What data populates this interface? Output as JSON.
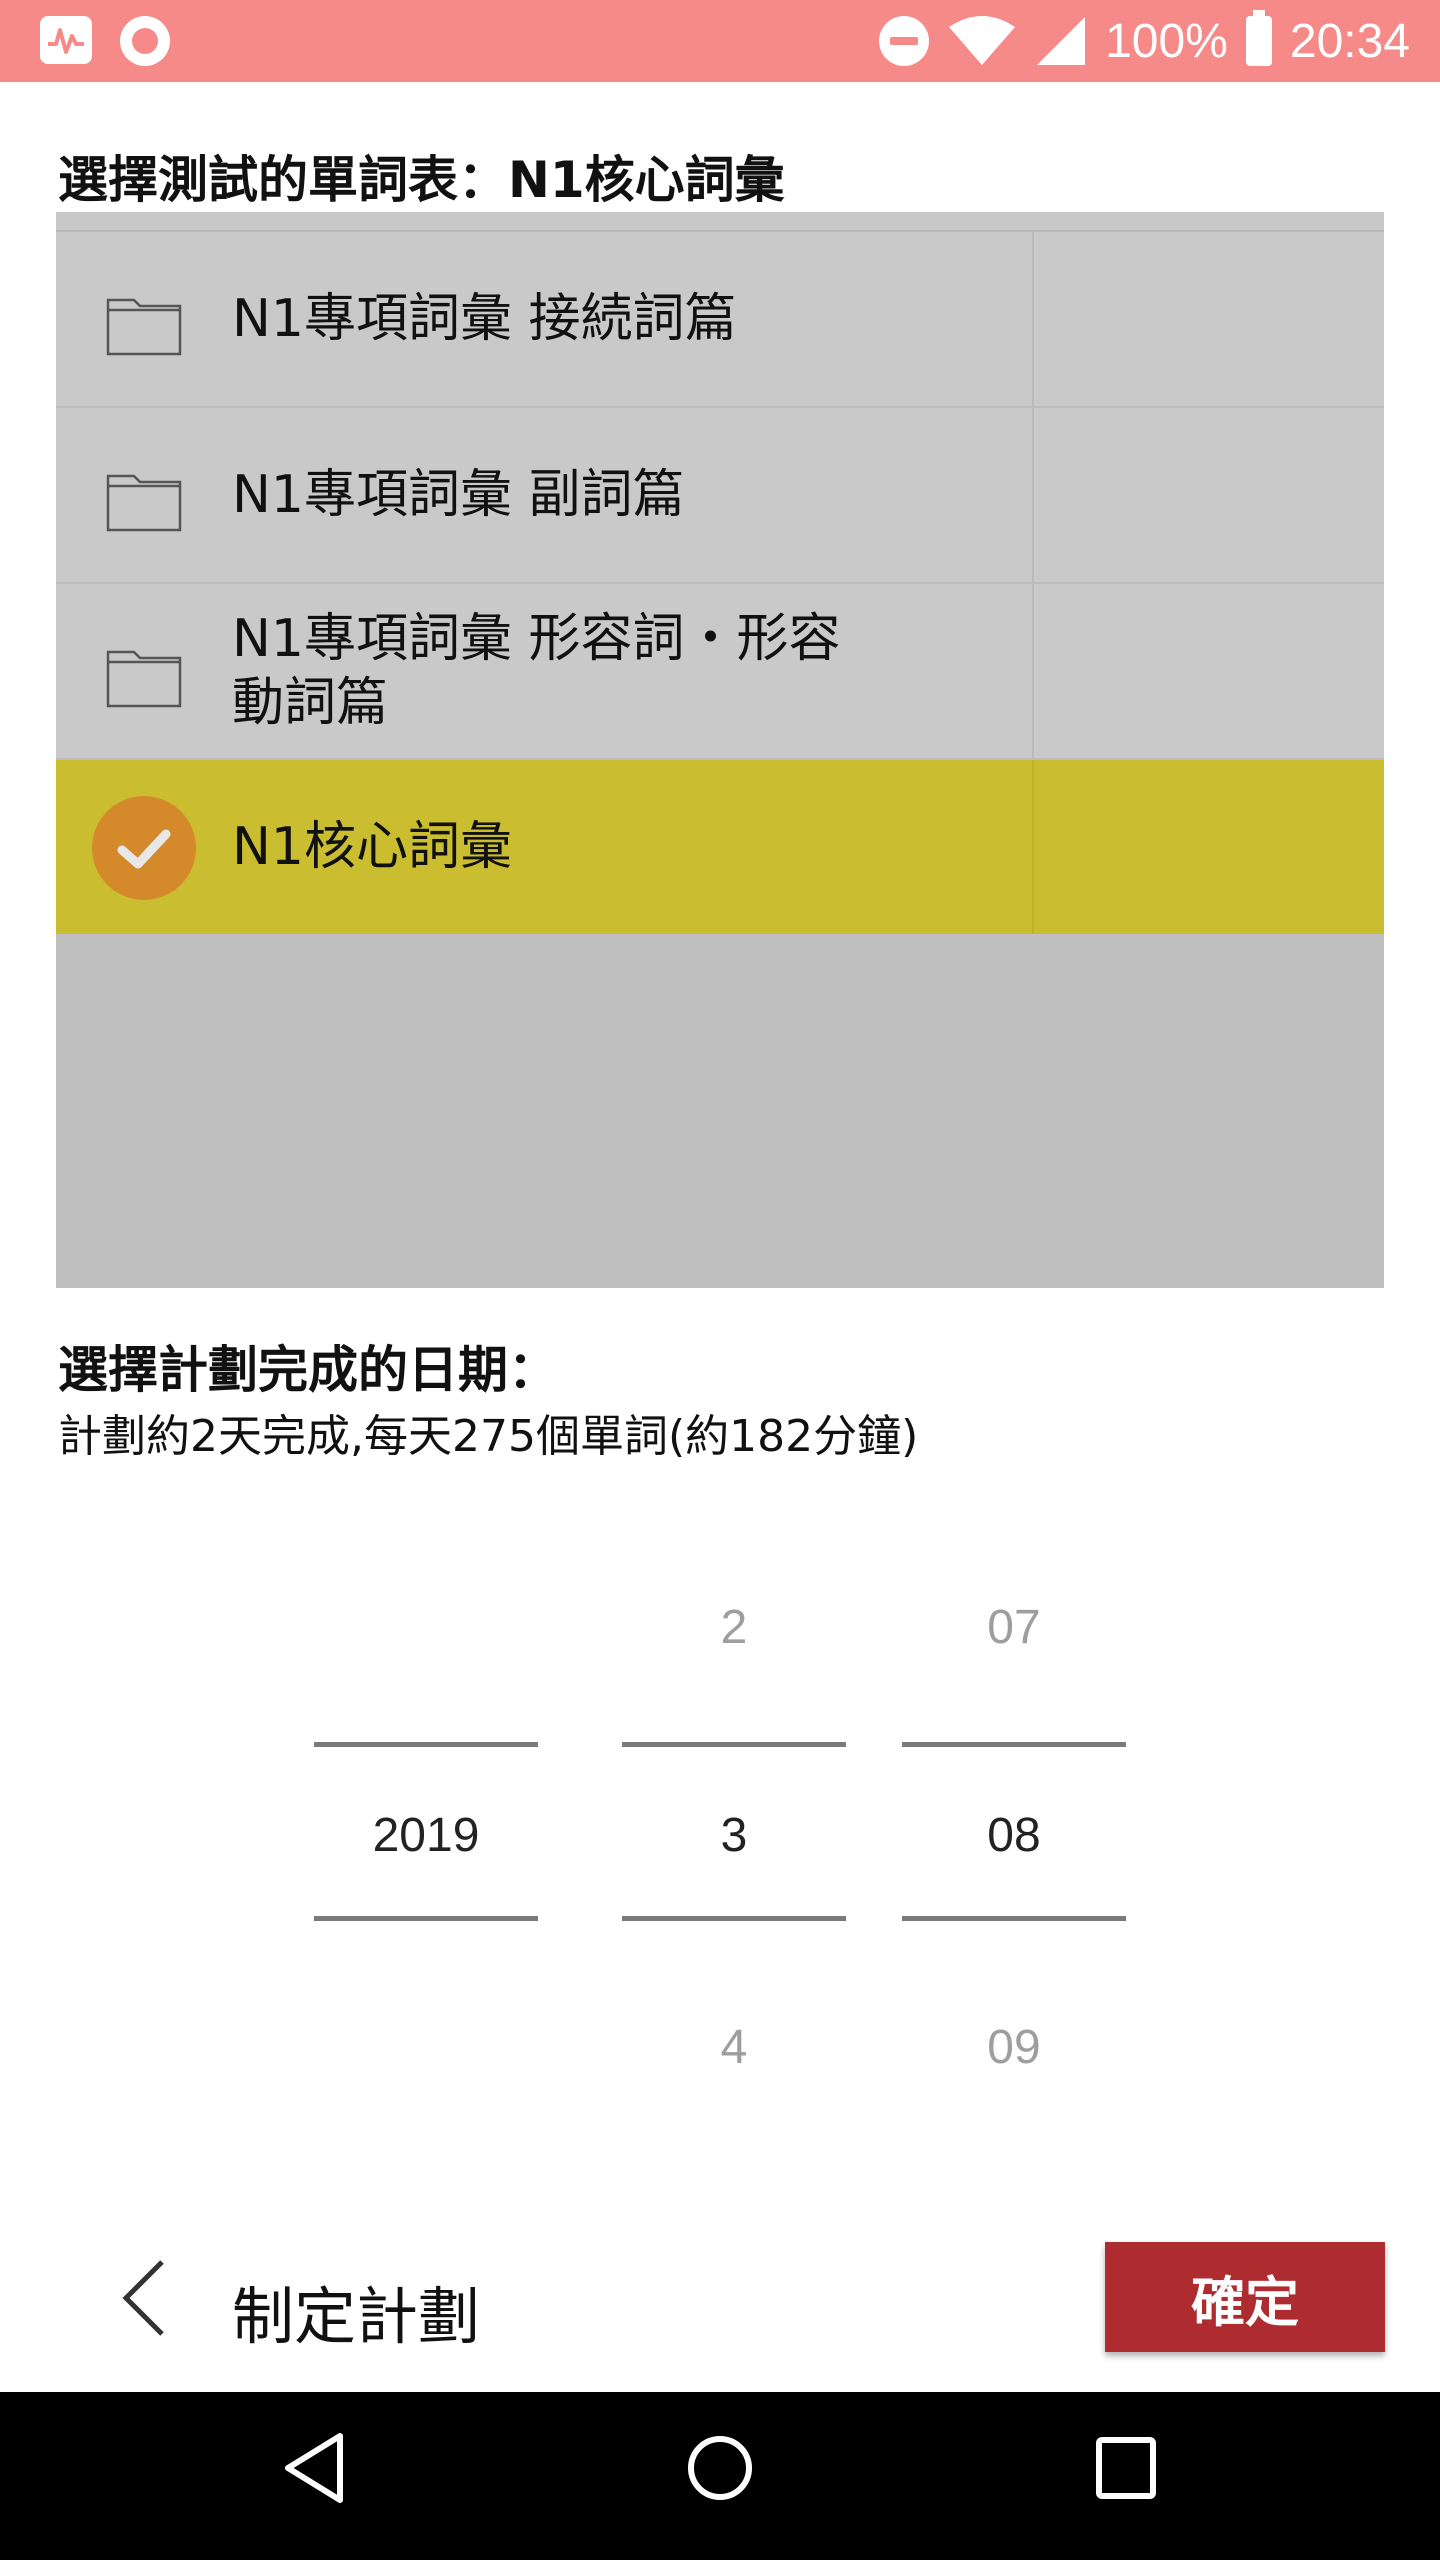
{
  "status_bar": {
    "battery": "100%",
    "time": "20:34",
    "icons": [
      "activity-icon",
      "record-icon",
      "do-not-disturb-icon",
      "wifi-icon",
      "signal-icon",
      "battery-charging-icon"
    ]
  },
  "wordlist_section": {
    "title": "選擇測試的單詞表：N1核心詞彙",
    "items": [
      {
        "label": "N1專項詞彙 接続詞篇",
        "icon": "folder-icon",
        "selected": false
      },
      {
        "label": "N1專項詞彙 副詞篇",
        "icon": "folder-icon",
        "selected": false
      },
      {
        "label": "N1專項詞彙 形容詞・形容動詞篇",
        "icon": "folder-icon",
        "selected": false
      },
      {
        "label": "N1核心詞彙",
        "icon": "check-icon",
        "selected": true
      }
    ]
  },
  "plan_section": {
    "title": "選擇計劃完成的日期：",
    "subtitle": "計劃約2天完成,每天275個單詞(約182分鐘)"
  },
  "date_picker": {
    "year": {
      "prev": "",
      "current": "2019",
      "next": ""
    },
    "month": {
      "prev": "2",
      "current": "3",
      "next": "4"
    },
    "day": {
      "prev": "07",
      "current": "08",
      "next": "09"
    }
  },
  "bottom_bar": {
    "title": "制定計劃",
    "confirm_label": "確定",
    "back_icon": "chevron-left-icon"
  },
  "nav_bar": {
    "icons": [
      "nav-back-icon",
      "nav-home-icon",
      "nav-recents-icon"
    ]
  },
  "colors": {
    "status_bar": "#f58a88",
    "selected_row": "#cbbd30",
    "check_circle": "#d4892a",
    "confirm_button": "#ae2c30"
  }
}
